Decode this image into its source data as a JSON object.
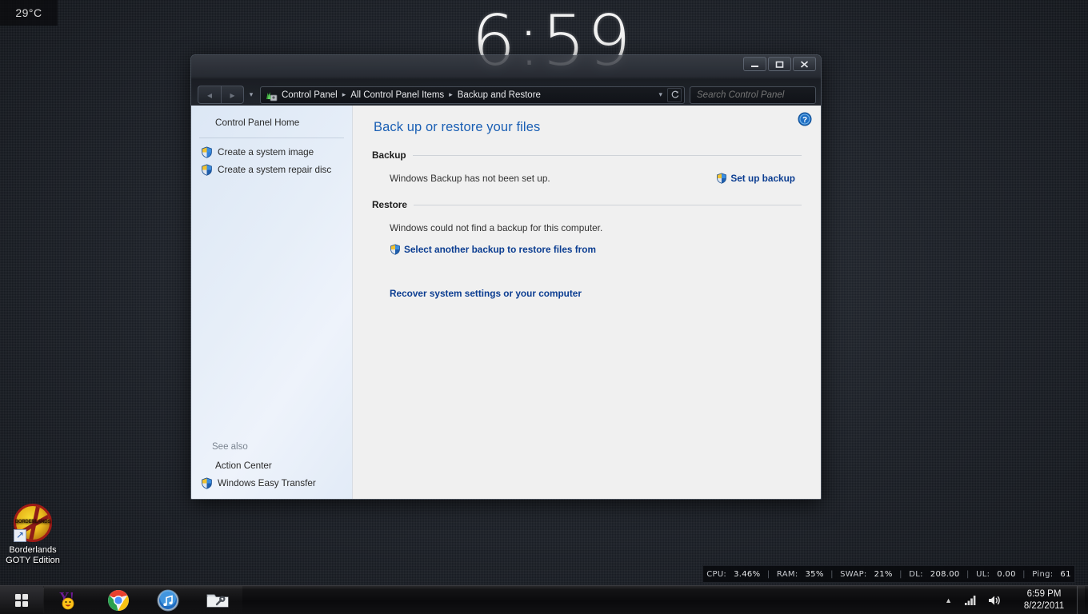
{
  "desktop": {
    "temperature_gadget": {
      "value": "29°C"
    },
    "clock_gadget": {
      "time": "6:59"
    },
    "icons": [
      {
        "name": "Borderlands GOTY Edition",
        "line1": "Borderlands",
        "line2": "GOTY Edition",
        "badge_text": "BORDERLANDS"
      }
    ]
  },
  "window": {
    "title": "Backup and Restore",
    "nav": {
      "back_label": "◂",
      "forward_label": "▸",
      "recent_pages_label": "▾",
      "address_dropdown_label": "▾",
      "refresh_label": "↻"
    },
    "breadcrumbs": [
      {
        "label": "Control Panel"
      },
      {
        "label": "All Control Panel Items"
      },
      {
        "label": "Backup and Restore"
      }
    ],
    "breadcrumb_separator": "▸",
    "search": {
      "placeholder": "Search Control Panel",
      "value": ""
    },
    "controls": {
      "minimize_label": "Minimize",
      "maximize_label": "Maximize",
      "close_label": "Close"
    }
  },
  "sidebar": {
    "home_label": "Control Panel Home",
    "items": [
      {
        "label": "Create a system image",
        "icon": "shield-icon"
      },
      {
        "label": "Create a system repair disc",
        "icon": "shield-icon"
      }
    ],
    "see_also_label": "See also",
    "see_also_items": [
      {
        "label": "Action Center",
        "icon": "none"
      },
      {
        "label": "Windows Easy Transfer",
        "icon": "shield-icon"
      }
    ]
  },
  "content": {
    "page_title": "Back up or restore your files",
    "help_label": "Help",
    "backup": {
      "heading": "Backup",
      "status_text": "Windows Backup has not been set up.",
      "action_label": "Set up backup"
    },
    "restore": {
      "heading": "Restore",
      "status_text": "Windows could not find a backup for this computer.",
      "select_backup_label": "Select another backup to restore files from",
      "recover_label": "Recover system settings or your computer"
    }
  },
  "system_monitor": {
    "metrics": [
      {
        "key": "CPU:",
        "value": "3.46%"
      },
      {
        "key": "RAM:",
        "value": "35%"
      },
      {
        "key": "SWAP:",
        "value": "21%"
      },
      {
        "key": "DL:",
        "value": "208.00"
      },
      {
        "key": "UL:",
        "value": "0.00"
      },
      {
        "key": "Ping:",
        "value": "61"
      }
    ],
    "separator": "|"
  },
  "taskbar": {
    "start_label": "Start",
    "pinned": [
      {
        "name": "yahoo-messenger",
        "label": "Yahoo! Messenger"
      },
      {
        "name": "google-chrome",
        "label": "Google Chrome"
      },
      {
        "name": "itunes",
        "label": "iTunes"
      },
      {
        "name": "file-explorer",
        "label": "Windows Explorer"
      }
    ],
    "tray": {
      "overflow_label": "▲",
      "network_label": "Network",
      "volume_label": "Volume"
    },
    "clock": {
      "time": "6:59 PM",
      "date": "8/22/2011"
    }
  },
  "colors": {
    "accent_blue": "#1a5fb4",
    "link_blue": "#0b3d91",
    "sidebar_start": "#dce7f5",
    "content_bg": "#f0f0f0",
    "chrome_dark": "#1a1d23"
  }
}
